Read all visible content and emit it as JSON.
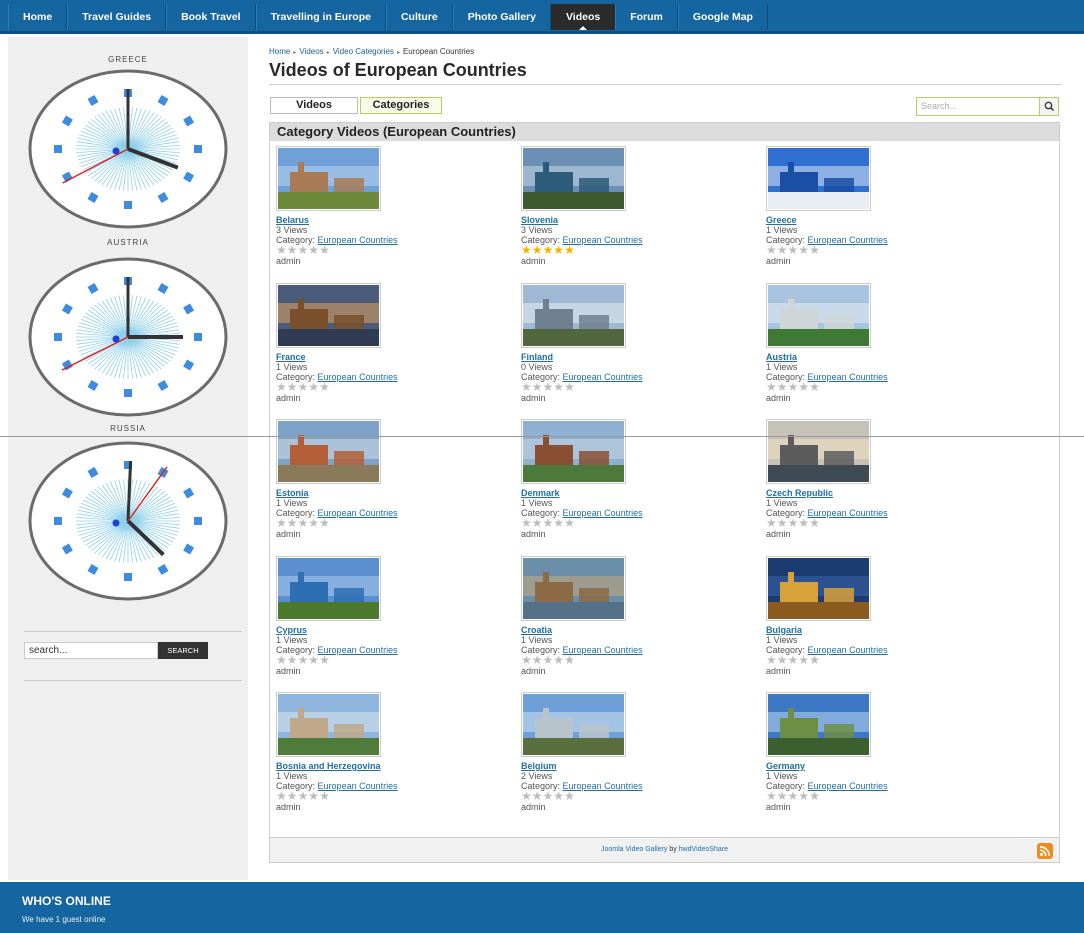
{
  "nav": {
    "items": [
      "Home",
      "Travel Guides",
      "Book Travel",
      "Travelling in Europe",
      "Culture",
      "Photo Gallery",
      "Videos",
      "Forum",
      "Google Map"
    ],
    "active": "Videos"
  },
  "sidebar": {
    "clocks": [
      {
        "label": "GREECE",
        "hour_angle": 115,
        "minute_angle": 0,
        "second_angle": 237
      },
      {
        "label": "AUSTRIA",
        "hour_angle": 90,
        "minute_angle": 0,
        "second_angle": 238
      },
      {
        "label": "RUSSIA",
        "hour_angle": 140,
        "minute_angle": 2,
        "second_angle": 30
      }
    ],
    "search": {
      "placeholder": "search...",
      "button": "SEARCH"
    }
  },
  "breadcrumb": [
    "Home",
    "Videos",
    "Video Categories",
    "European Countries"
  ],
  "page_title": "Videos of European Countries",
  "tabs": {
    "videos": "Videos",
    "categories": "Categories"
  },
  "search": {
    "placeholder": "Search..."
  },
  "panel_title": "Category Videos (European Countries)",
  "category_prefix": "Category:",
  "videos": [
    {
      "title": "Belarus",
      "views": "3 Views",
      "category": "European Countries",
      "user": "admin",
      "rating": 0,
      "palette": [
        "#6fa0d8",
        "#b9d3ee",
        "#a87a55",
        "#6d8a3b"
      ]
    },
    {
      "title": "Slovenia",
      "views": "3 Views",
      "category": "European Countries",
      "user": "admin",
      "rating": 5,
      "palette": [
        "#6c8fb5",
        "#c7d8e8",
        "#2d5c7a",
        "#3d5a2f"
      ]
    },
    {
      "title": "Greece",
      "views": "1 Views",
      "category": "European Countries",
      "user": "admin",
      "rating": 0,
      "palette": [
        "#2f6fcf",
        "#d9e6f5",
        "#1b4fa6",
        "#e9eef5"
      ]
    },
    {
      "title": "France",
      "views": "1 Views",
      "category": "European Countries",
      "user": "admin",
      "rating": 0,
      "palette": [
        "#4b5c7a",
        "#e0a35b",
        "#7a4f2c",
        "#2e3b53"
      ]
    },
    {
      "title": "Finland",
      "views": "0 Views",
      "category": "European Countries",
      "user": "admin",
      "rating": 0,
      "palette": [
        "#9fb8d3",
        "#e8eef4",
        "#6f7f8f",
        "#51683f"
      ]
    },
    {
      "title": "Austria",
      "views": "1 Views",
      "category": "European Countries",
      "user": "admin",
      "rating": 0,
      "palette": [
        "#a8c4e0",
        "#e3ebf3",
        "#cfd6d8",
        "#3f7a35"
      ]
    },
    {
      "title": "Estonia",
      "views": "1 Views",
      "category": "European Countries",
      "user": "admin",
      "rating": 0,
      "palette": [
        "#7ea2c8",
        "#d2dce6",
        "#b55f38",
        "#8a7a5a"
      ]
    },
    {
      "title": "Denmark",
      "views": "1 Views",
      "category": "European Countries",
      "user": "admin",
      "rating": 0,
      "palette": [
        "#8fb0d0",
        "#c9d6e2",
        "#8a4f33",
        "#4d7a3a"
      ]
    },
    {
      "title": "Czech Republic",
      "views": "1 Views",
      "category": "European Countries",
      "user": "admin",
      "rating": 0,
      "palette": [
        "#c7c2b9",
        "#f1e1c1",
        "#5c5c5c",
        "#3e4b55"
      ]
    },
    {
      "title": "Cyprus",
      "views": "1 Views",
      "category": "European Countries",
      "user": "admin",
      "rating": 0,
      "palette": [
        "#5b8fd0",
        "#a9c9ea",
        "#2d6fb3",
        "#4c7a2d"
      ]
    },
    {
      "title": "Croatia",
      "views": "1 Views",
      "category": "European Countries",
      "user": "admin",
      "rating": 0,
      "palette": [
        "#6b8fa8",
        "#c4a77a",
        "#8b6a45",
        "#55718a"
      ]
    },
    {
      "title": "Bulgaria",
      "views": "1 Views",
      "category": "European Countries",
      "user": "admin",
      "rating": 0,
      "palette": [
        "#1c3b6e",
        "#3a66b0",
        "#d8a13a",
        "#8a5a1f"
      ]
    },
    {
      "title": "Bosnia and Herzegovina",
      "views": "1 Views",
      "category": "European Countries",
      "user": "admin",
      "rating": 0,
      "palette": [
        "#8fb6dc",
        "#d9e5ef",
        "#c0a98a",
        "#4f7c3b"
      ]
    },
    {
      "title": "Belgium",
      "views": "2 Views",
      "category": "European Countries",
      "user": "admin",
      "rating": 0,
      "palette": [
        "#6f9fd8",
        "#cfe1f3",
        "#b8c4cc",
        "#5a6f3e"
      ]
    },
    {
      "title": "Germany",
      "views": "1 Views",
      "category": "European Countries",
      "user": "admin",
      "rating": 0,
      "palette": [
        "#3d78c4",
        "#b9d6f2",
        "#6c8f45",
        "#3b5f2e"
      ]
    }
  ],
  "footer": {
    "text_a": "Joomla Video Gallery",
    "text_by": " by ",
    "text_b": "hwdVideoShare"
  },
  "whos_online": {
    "heading": "WHO'S ONLINE",
    "text": "We have 1 guest online"
  }
}
